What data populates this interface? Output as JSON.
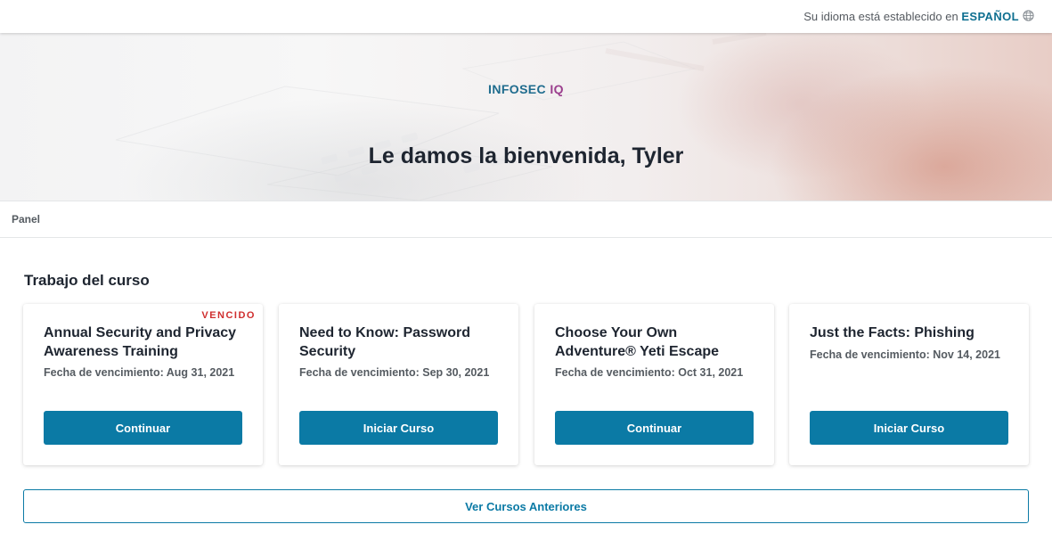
{
  "language_bar": {
    "prefix": "Su idioma está establecido en",
    "language": "ESPAÑOL",
    "icon": "globe-icon"
  },
  "hero": {
    "brand_main": "INFOSEC",
    "brand_accent": "IQ",
    "welcome": "Le damos la bienvenida, Tyler"
  },
  "breadcrumb": {
    "label": "Panel"
  },
  "coursework": {
    "title": "Trabajo del curso",
    "cards": [
      {
        "title": "Annual Security and Privacy Awareness Training",
        "due": "Fecha de vencimiento: Aug 31, 2021",
        "status": "VENCIDO",
        "button": "Continuar"
      },
      {
        "title": "Need to Know: Password Security",
        "due": "Fecha de vencimiento: Sep 30, 2021",
        "status": "",
        "button": "Iniciar Curso"
      },
      {
        "title": "Choose Your Own Adventure® Yeti Escape",
        "due": "Fecha de vencimiento: Oct 31, 2021",
        "status": "",
        "button": "Continuar"
      },
      {
        "title": "Just the Facts: Phishing",
        "due": "Fecha de vencimiento: Nov 14, 2021",
        "status": "",
        "button": "Iniciar Curso"
      }
    ],
    "history_button": "Ver Cursos Anteriores"
  },
  "colors": {
    "primary": "#0b7aa5",
    "brand_blue": "#1f6c8e",
    "brand_purple": "#9b3f8e",
    "overdue": "#cf2e2e"
  }
}
